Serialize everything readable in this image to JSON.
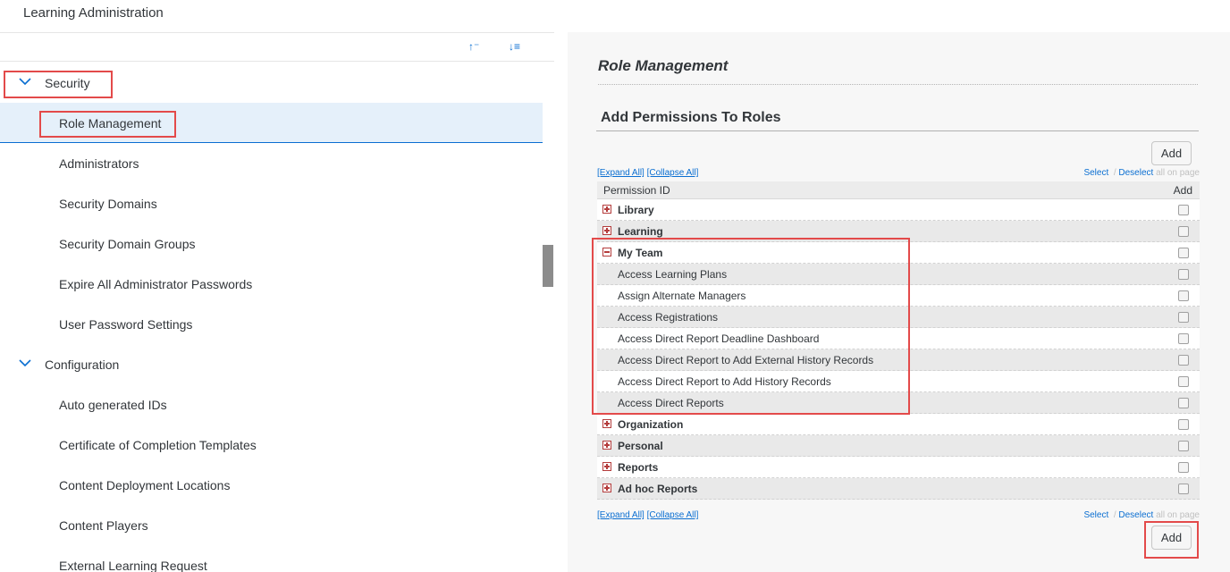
{
  "header": {
    "title": "Learning Administration"
  },
  "toolbar": {
    "sort_asc_icon": "↑⁻",
    "sort_desc_icon": "↓≡"
  },
  "tree": {
    "security": {
      "label": "Security",
      "items": [
        "Role Management",
        "Administrators",
        "Security Domains",
        "Security Domain Groups",
        "Expire All Administrator Passwords",
        "User Password Settings"
      ]
    },
    "configuration": {
      "label": "Configuration",
      "items": [
        "Auto generated IDs",
        "Certificate of Completion Templates",
        "Content Deployment Locations",
        "Content Players",
        "External Learning Request"
      ]
    }
  },
  "main": {
    "title": "Role Management",
    "section_title": "Add Permissions To Roles",
    "add_label": "Add",
    "expand_all": "[Expand All]",
    "collapse_all": "[Collapse All]",
    "select": "Select",
    "slash": "/",
    "deselect": "Deselect",
    "all_on_page": "all on page",
    "col_permission_id": "Permission ID",
    "col_add": "Add",
    "rows": [
      {
        "label": "Library",
        "type": "category",
        "state": "collapsed"
      },
      {
        "label": "Learning",
        "type": "category",
        "state": "collapsed"
      },
      {
        "label": "My Team",
        "type": "category",
        "state": "expanded"
      },
      {
        "label": "Access Learning Plans",
        "type": "item"
      },
      {
        "label": "Assign Alternate Managers",
        "type": "item"
      },
      {
        "label": "Access Registrations",
        "type": "item"
      },
      {
        "label": "Access Direct Report Deadline Dashboard",
        "type": "item"
      },
      {
        "label": "Access Direct Report to Add External History Records",
        "type": "item"
      },
      {
        "label": "Access Direct Report to Add History Records",
        "type": "item"
      },
      {
        "label": "Access Direct Reports",
        "type": "item"
      },
      {
        "label": "Organization",
        "type": "category",
        "state": "collapsed"
      },
      {
        "label": "Personal",
        "type": "category",
        "state": "collapsed"
      },
      {
        "label": "Reports",
        "type": "category",
        "state": "collapsed"
      },
      {
        "label": "Ad hoc Reports",
        "type": "category",
        "state": "collapsed"
      }
    ]
  },
  "colors": {
    "accent": "#0a6ed1",
    "highlight": "#e34a4a",
    "selected_row": "#e5f0fa",
    "expander": "#b43c3c"
  }
}
